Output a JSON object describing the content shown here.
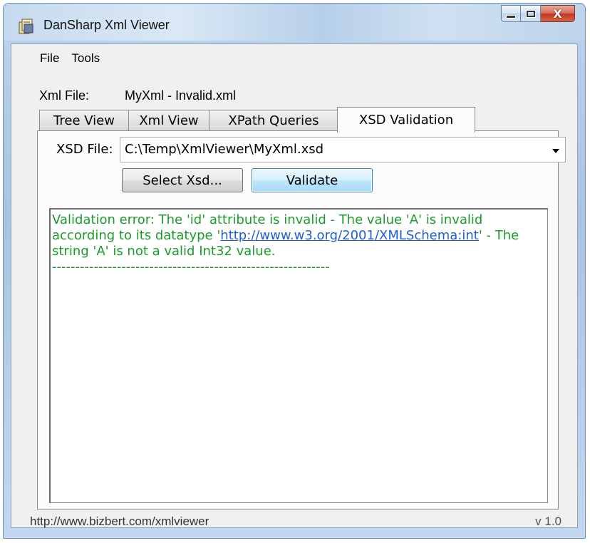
{
  "window": {
    "title": "DanSharp Xml Viewer",
    "app_icon": "app-icon",
    "caption_buttons": [
      "minimize",
      "maximize",
      "close"
    ],
    "close_glyph": "X"
  },
  "menu": {
    "items": [
      {
        "label": "File"
      },
      {
        "label": "Tools"
      }
    ]
  },
  "file_info": {
    "label": "Xml File:",
    "name": "MyXml - Invalid.xml"
  },
  "tabs": [
    {
      "label": "Tree View",
      "active": false
    },
    {
      "label": "Xml View",
      "active": false
    },
    {
      "label": "XPath Queries",
      "active": false
    },
    {
      "label": "XSD Validation",
      "active": true
    }
  ],
  "xsd": {
    "label": "XSD File:",
    "selected": "C:\\Temp\\XmlViewer\\MyXml.xsd",
    "select_button": "Select Xsd...",
    "validate_button": "Validate"
  },
  "results": {
    "text_before_link": "Validation error: The 'id' attribute is invalid - The value 'A' is invalid according to its datatype '",
    "link": "http://www.w3.org/2001/XMLSchema:int",
    "text_after_link": "' - The string 'A' is not a valid Int32 value.",
    "separator": "------------------------------------------------------------",
    "text_color": "#1c9b2c",
    "link_color": "#1f5fd6"
  },
  "status": {
    "url": "http://www.bizbert.com/xmlviewer",
    "version": "v 1.0"
  }
}
